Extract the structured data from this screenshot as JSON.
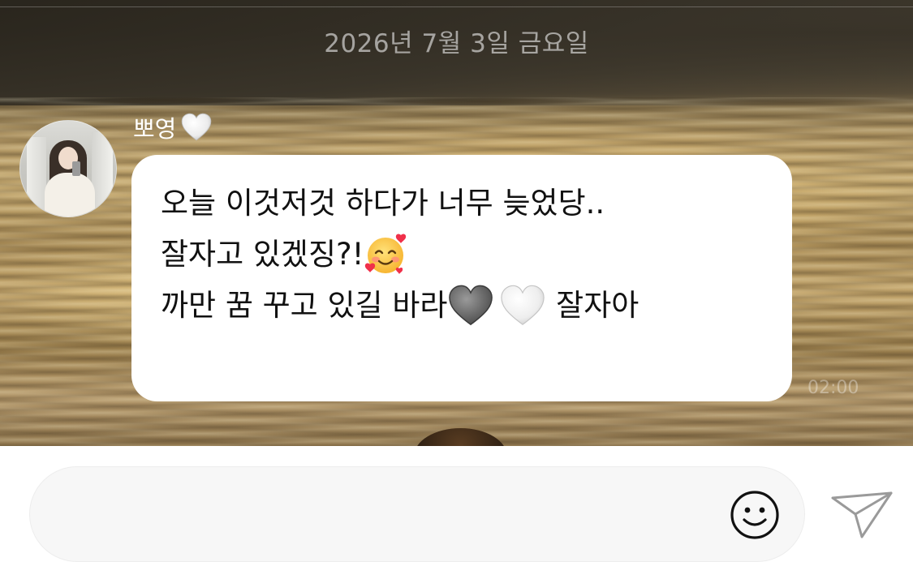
{
  "chat": {
    "date_separator": "2026년 7월 3일 금요일",
    "sender": {
      "name": "뽀영",
      "name_heart_icon": "white-heart-icon"
    },
    "message": {
      "lines": [
        {
          "text": "오늘 이것저것 하다가 너무 늦었당.."
        },
        {
          "text": "잘자고 있겠징?!",
          "trailing_emoji": "smiling-face-with-hearts-emoji"
        },
        {
          "text_before": "까만 꿈 꾸고 있길 바라",
          "emojis": [
            "grey-heart-icon",
            "white-heart-icon"
          ],
          "text_after": " 잘자아"
        }
      ],
      "timestamp": "02:00"
    }
  },
  "composer": {
    "input_value": "",
    "input_placeholder": "",
    "emoji_icon": "smiley-icon",
    "send_icon": "paper-plane-icon"
  },
  "colors": {
    "bubble": "#ffffff",
    "text": "#111111",
    "date_text": "#ebebeb",
    "input_bg": "#f7f7f7",
    "icon": "#111111",
    "send_icon": "#9a9a9a"
  }
}
